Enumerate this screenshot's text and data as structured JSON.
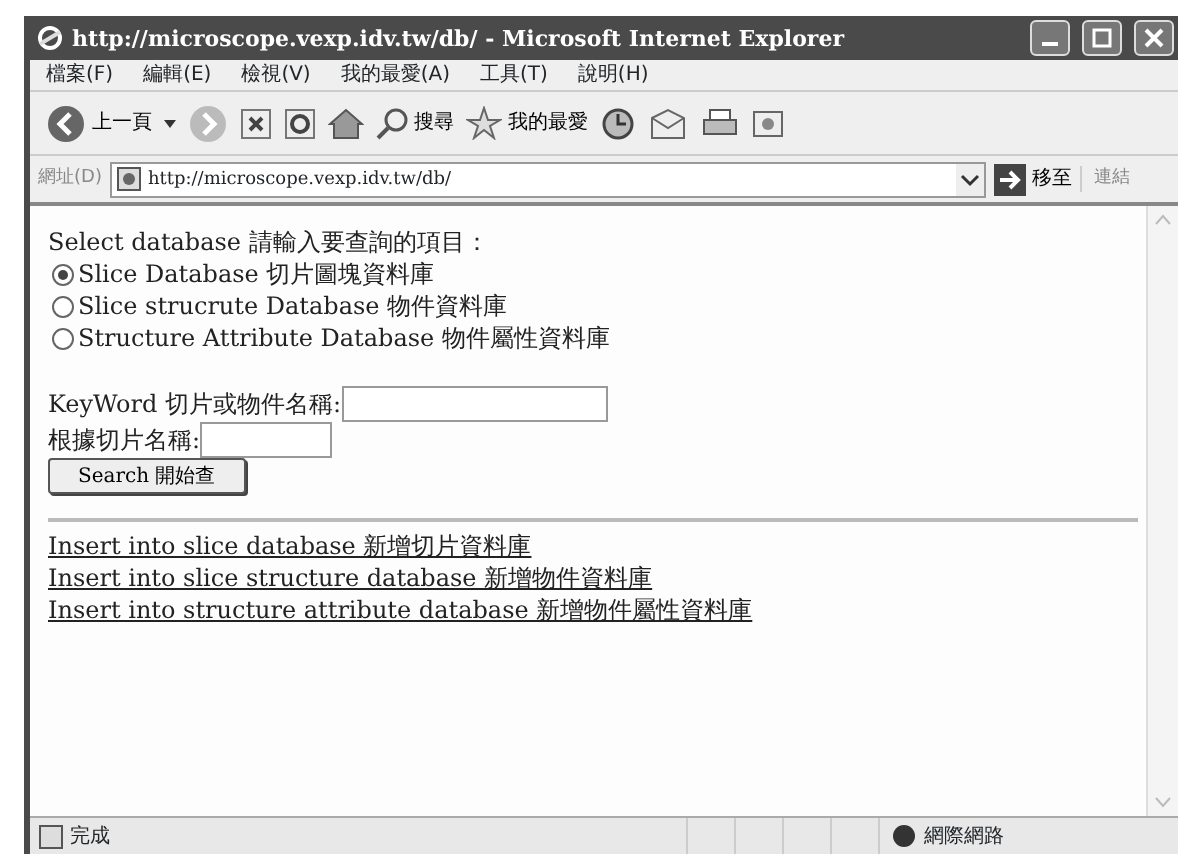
{
  "window": {
    "title": "http://microscope.vexp.idv.tw/db/ - Microsoft Internet Explorer"
  },
  "menu": [
    {
      "label": "檔案(F)"
    },
    {
      "label": "編輯(E)"
    },
    {
      "label": "檢視(V)"
    },
    {
      "label": "我的最愛(A)"
    },
    {
      "label": "工具(T)"
    },
    {
      "label": "說明(H)"
    }
  ],
  "toolbar": {
    "back": "上一頁",
    "search": "搜尋",
    "favorites": "我的最愛"
  },
  "address_bar": {
    "label": "網址(D)",
    "url": "http://microscope.vexp.idv.tw/db/",
    "go": "移至",
    "links": "連結"
  },
  "form": {
    "heading": "Select database 請輸入要查詢的項目：",
    "options": [
      {
        "label": "Slice Database 切片圖塊資料庫",
        "selected": true
      },
      {
        "label": "Slice strucrute Database 物件資料庫",
        "selected": false
      },
      {
        "label": "Structure Attribute Database 物件屬性資料庫",
        "selected": false
      }
    ],
    "fields": [
      {
        "label": "KeyWord 切片或物件名稱:",
        "kind": "wide"
      },
      {
        "label": "根據切片名稱:",
        "kind": "narrow"
      }
    ],
    "button": "Search 開始查"
  },
  "links": [
    {
      "label": "Insert into slice database 新增切片資料庫"
    },
    {
      "label": "Insert into slice structure database 新增物件資料庫"
    },
    {
      "label": "Insert into structure attribute database 新增物件屬性資料庫"
    }
  ],
  "status_bar": {
    "text": "完成",
    "zone": "網際網路"
  }
}
